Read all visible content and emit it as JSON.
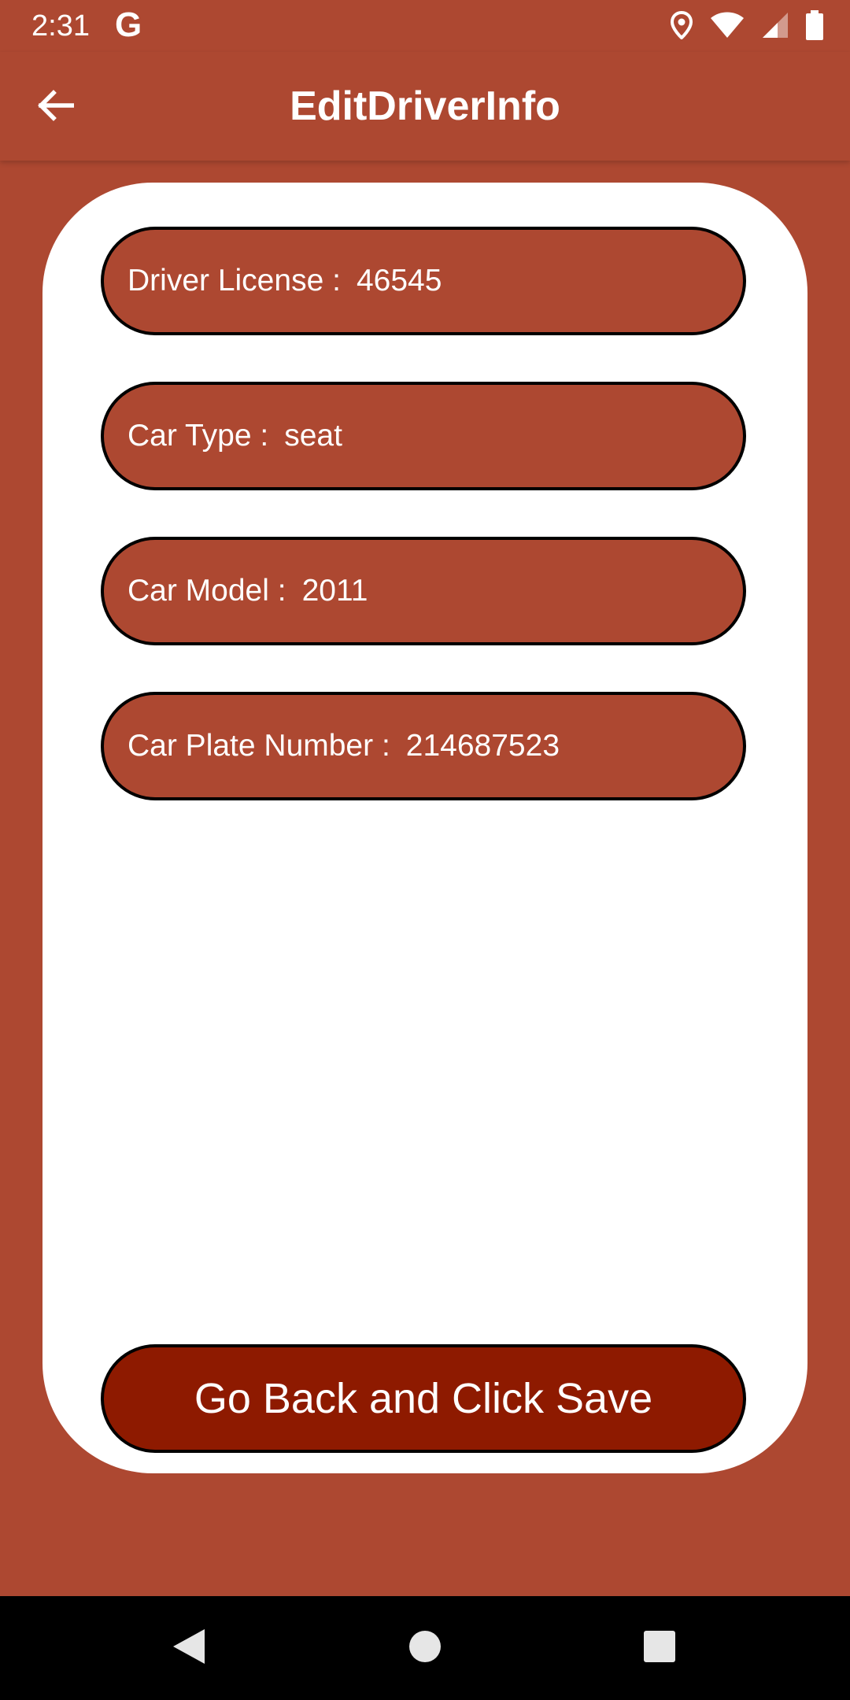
{
  "status_bar": {
    "time": "2:31",
    "g_label": "G",
    "icons": [
      "location-icon",
      "wifi-icon",
      "signal-icon",
      "battery-icon"
    ]
  },
  "app_bar": {
    "title": "EditDriverInfo",
    "back_icon": "arrow-left-icon"
  },
  "fields": [
    {
      "label": "Driver License :",
      "value": "46545"
    },
    {
      "label": "Car Type :",
      "value": "seat"
    },
    {
      "label": "Car Model :",
      "value": "2011"
    },
    {
      "label": "Car Plate Number :",
      "value": "214687523"
    }
  ],
  "save_button": {
    "label": "Go Back and Click Save"
  },
  "nav_bar": {
    "icons": [
      "back-triangle-icon",
      "home-circle-icon",
      "recents-square-icon"
    ]
  },
  "colors": {
    "primary": "#AD4831",
    "button": "#8E1A00",
    "card": "#FFFFFF"
  }
}
